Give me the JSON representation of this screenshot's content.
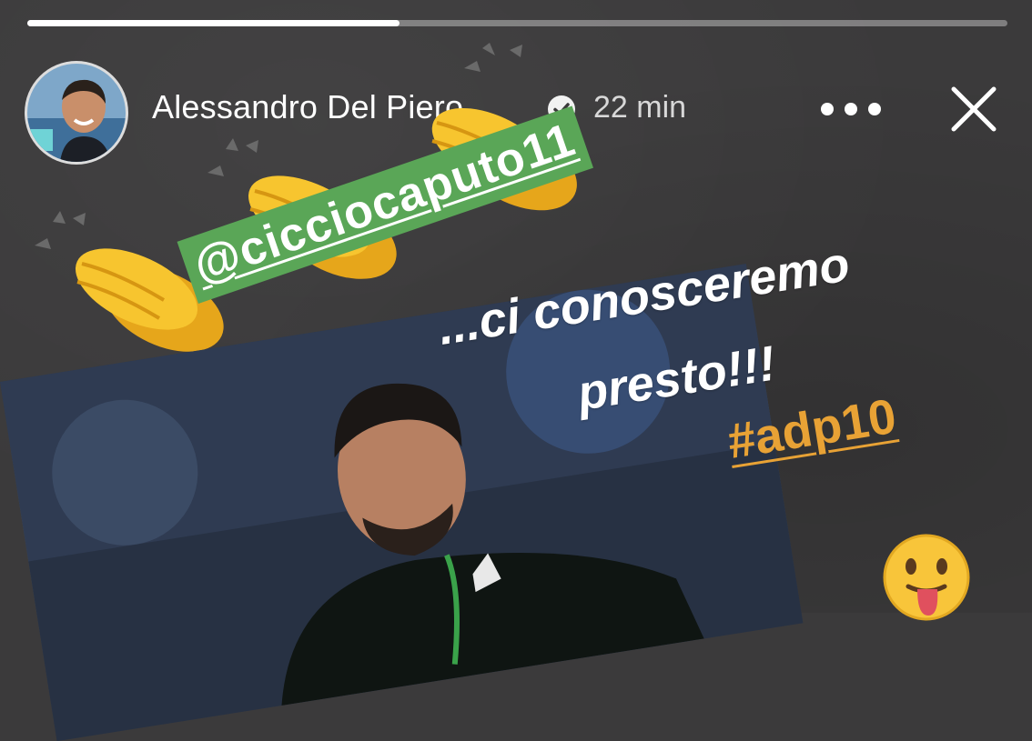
{
  "story": {
    "progress": 0.38,
    "user": {
      "name": "Alessandro Del Piero",
      "verified": true,
      "time": "22 min"
    },
    "header_icons": {
      "verified": "verified-badge-icon",
      "more": "more-options-icon",
      "close": "close-icon"
    },
    "stickers": {
      "mention": "@cicciocaputo11",
      "caption_line1": "...ci conosceremo",
      "caption_line2": "presto!!!",
      "hashtag": "#adp10",
      "emojis": [
        "clapping-hands",
        "clapping-hands",
        "clapping-hands",
        "face-with-tongue"
      ]
    },
    "colors": {
      "background": "#3b3a3b",
      "mention_bg": "#5aa657",
      "hashtag": "#e8a235"
    }
  }
}
